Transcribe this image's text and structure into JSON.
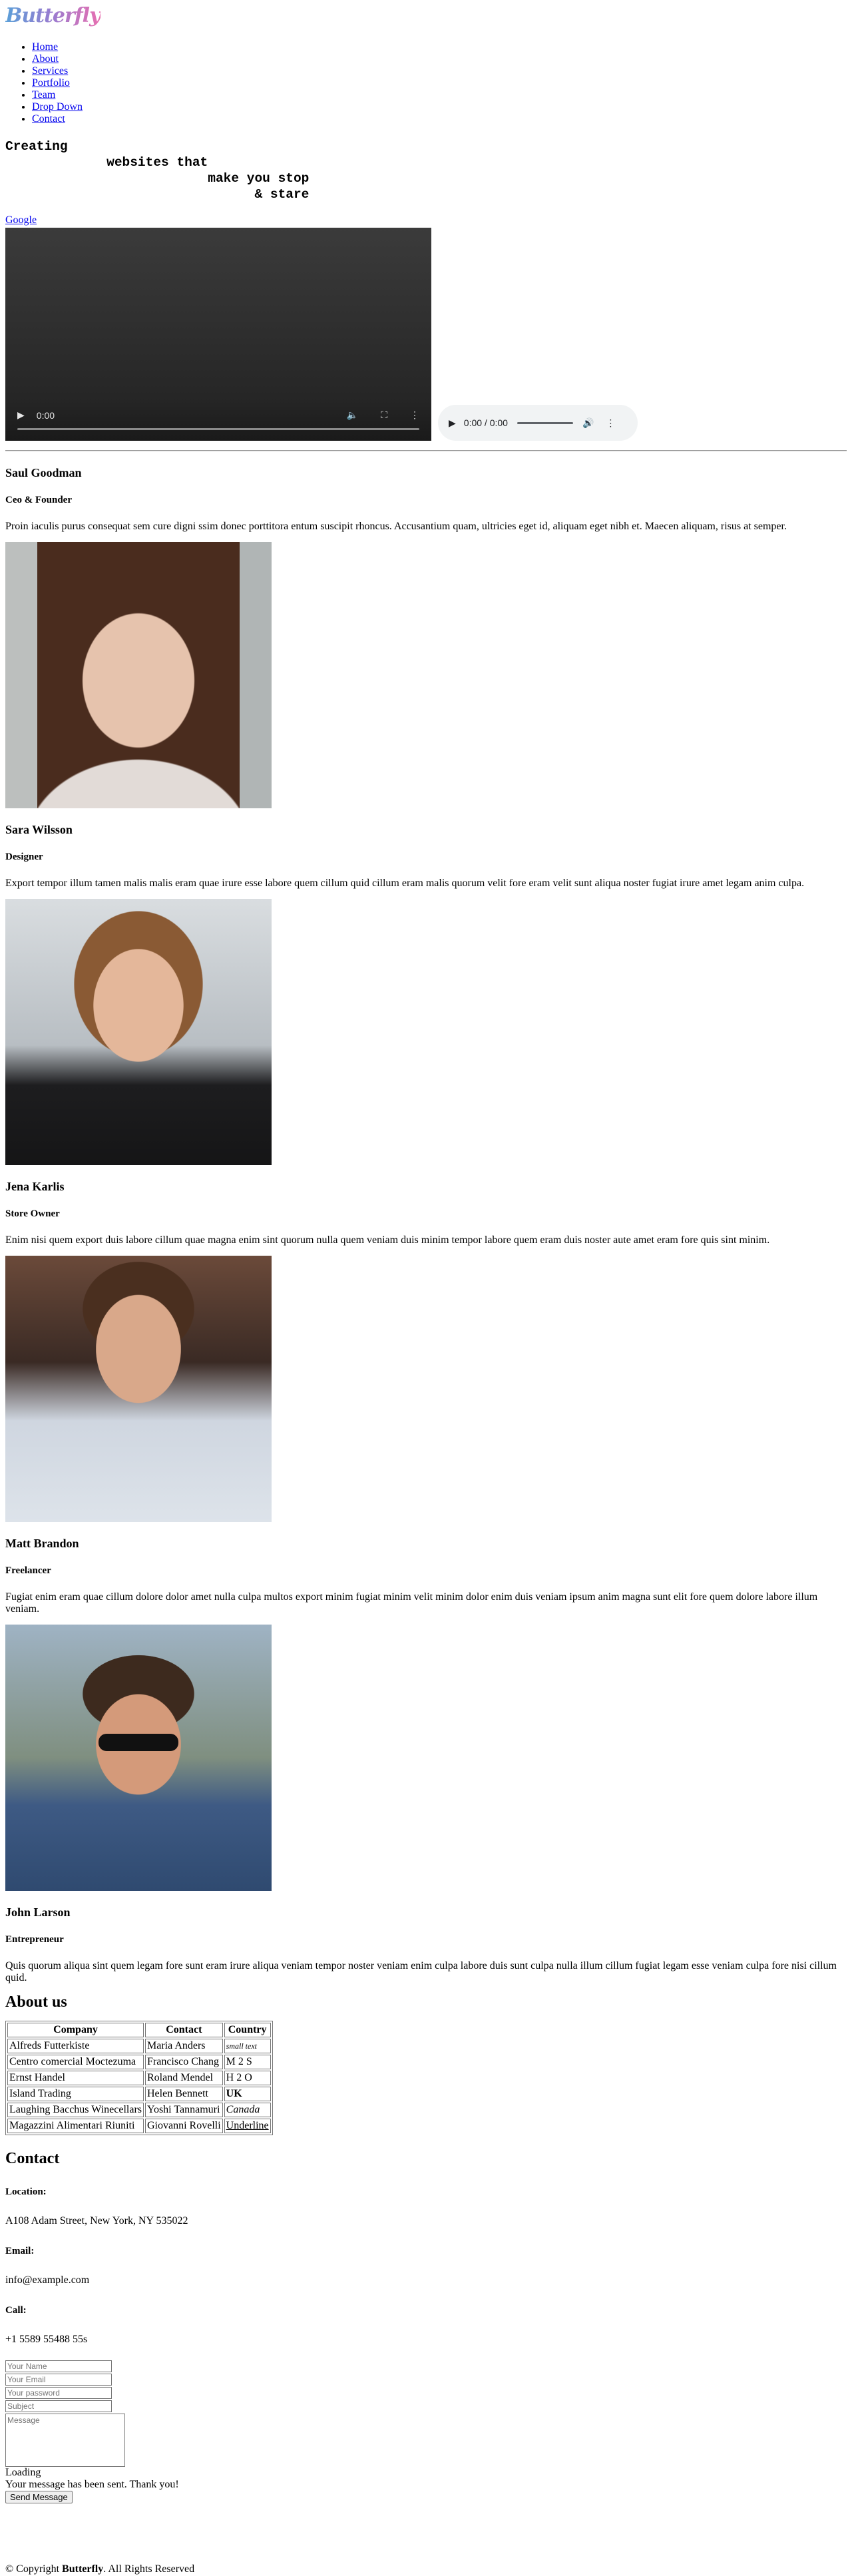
{
  "logo": {
    "text": "Butterfly"
  },
  "nav": [
    "Home",
    "About",
    "Services",
    "Portfolio",
    "Team",
    "Drop Down",
    "Contact"
  ],
  "tagline": "Creating\n             websites that\n                          make you stop\n                                & stare",
  "google_link": "Google",
  "video": {
    "time": "0:00",
    "icons": [
      "play-icon",
      "volume-icon",
      "fullscreen-icon",
      "more-icon"
    ]
  },
  "audio": {
    "time": "0:00 / 0:00"
  },
  "team": [
    {
      "name": "Saul Goodman",
      "role": "Ceo & Founder",
      "bio": "Proin iaculis purus consequat sem cure digni ssim donec porttitora entum suscipit rhoncus. Accusantium quam, ultricies eget id, aliquam eget nibh et. Maecen aliquam, risus at semper."
    },
    {
      "name": "Sara Wilsson",
      "role": "Designer",
      "bio": "Export tempor illum tamen malis malis eram quae irure esse labore quem cillum quid cillum eram malis quorum velit fore eram velit sunt aliqua noster fugiat irure amet legam anim culpa."
    },
    {
      "name": "Jena Karlis",
      "role": "Store Owner",
      "bio": "Enim nisi quem export duis labore cillum quae magna enim sint quorum nulla quem veniam duis minim tempor labore quem eram duis noster aute amet eram fore quis sint minim."
    },
    {
      "name": "Matt Brandon",
      "role": "Freelancer",
      "bio": "Fugiat enim eram quae cillum dolore dolor amet nulla culpa multos export minim fugiat minim velit minim dolor enim duis veniam ipsum anim magna sunt elit fore quem dolore labore illum veniam."
    },
    {
      "name": "John Larson",
      "role": "Entrepreneur",
      "bio": "Quis quorum aliqua sint quem legam fore sunt eram irure aliqua veniam tempor noster veniam enim culpa labore duis sunt culpa nulla illum cillum fugiat legam esse veniam culpa fore nisi cillum quid."
    }
  ],
  "about": {
    "title": "About us",
    "headers": [
      "Company",
      "Contact",
      "Country"
    ],
    "rows": [
      [
        "Alfreds Futterkiste",
        "Maria Anders",
        "small text"
      ],
      [
        "Centro comercial Moctezuma",
        "Francisco Chang",
        "M 2 S"
      ],
      [
        "Ernst Handel",
        "Roland Mendel",
        "H 2 O"
      ],
      [
        "Island Trading",
        "Helen Bennett",
        "UK"
      ],
      [
        "Laughing Bacchus Winecellars",
        "Yoshi Tannamuri",
        "Canada"
      ],
      [
        "Magazzini Alimentari Riuniti",
        "Giovanni Rovelli",
        "Underline"
      ]
    ]
  },
  "contact": {
    "title": "Contact",
    "location_label": "Location:",
    "location": "A108 Adam Street, New York, NY 535022",
    "email_label": "Email:",
    "email": "info@example.com",
    "call_label": "Call:",
    "call": "+1 5589 55488 55s",
    "placeholders": {
      "name": "Your Name",
      "email": "Your Email",
      "password": "Your password",
      "subject": "Subject",
      "message": "Message"
    },
    "loading": "Loading",
    "sent": "Your message has been sent. Thank you!",
    "send": "Send Message"
  },
  "footer": {
    "prefix": "© Copyright ",
    "brand": "Butterfly",
    "suffix": ". All Rights Reserved"
  }
}
